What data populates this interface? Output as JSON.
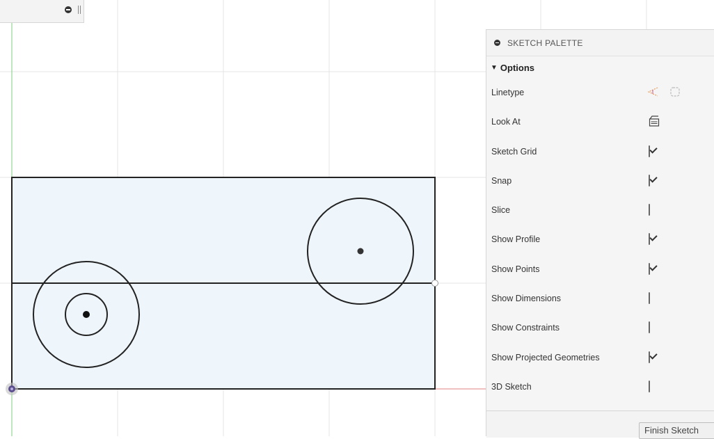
{
  "palette": {
    "title": "SKETCH PALETTE",
    "section": "Options",
    "section_arrow": "▼",
    "rows": [
      {
        "label": "Linetype",
        "control": "linetype-icons"
      },
      {
        "label": "Look At",
        "control": "look-at-icon"
      },
      {
        "label": "Sketch Grid",
        "checked": true
      },
      {
        "label": "Snap",
        "checked": true
      },
      {
        "label": "Slice",
        "checked": false
      },
      {
        "label": "Show Profile",
        "checked": true
      },
      {
        "label": "Show Points",
        "checked": true
      },
      {
        "label": "Show Dimensions",
        "checked": false
      },
      {
        "label": "Show Constraints",
        "checked": false
      },
      {
        "label": "Show Projected Geometries",
        "checked": true
      },
      {
        "label": "3D Sketch",
        "checked": false
      }
    ],
    "finish_button": "Finish Sketch"
  },
  "icons": {
    "linetype_1": "construction-linetype-icon",
    "linetype_2": "centerline-linetype-icon",
    "look_at": "look-at-icon",
    "collapse": "minus-circle-icon"
  },
  "colors": {
    "profile_fill": "#eef5fb",
    "sketch_line": "#222222",
    "grid": "#e4e4e4",
    "y_axis": "#7ccf7c",
    "x_axis": "#e08080"
  }
}
